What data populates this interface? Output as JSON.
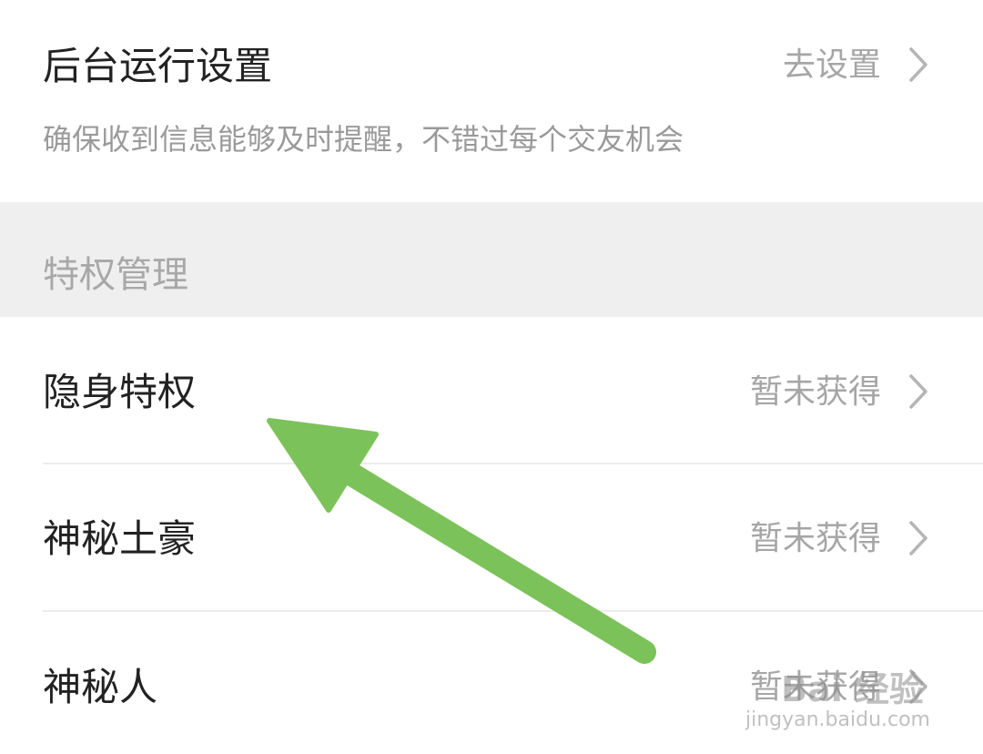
{
  "background_run": {
    "title": "后台运行设置",
    "action": "去设置",
    "description": "确保收到信息能够及时提醒，不错过每个交友机会"
  },
  "section": {
    "title": "特权管理"
  },
  "privileges": [
    {
      "label": "隐身特权",
      "status": "暂未获得"
    },
    {
      "label": "神秘土豪",
      "status": "暂未获得"
    },
    {
      "label": "神秘人",
      "status": "暂未获得"
    }
  ],
  "annotation": {
    "arrow_color": "#7cc25a"
  },
  "watermark": {
    "logo_text": "Bai 经验",
    "url": "jingyan.baidu.com"
  },
  "colors": {
    "section_bg": "#efefef",
    "text_primary": "#222222",
    "text_secondary": "#a6a6a6"
  }
}
